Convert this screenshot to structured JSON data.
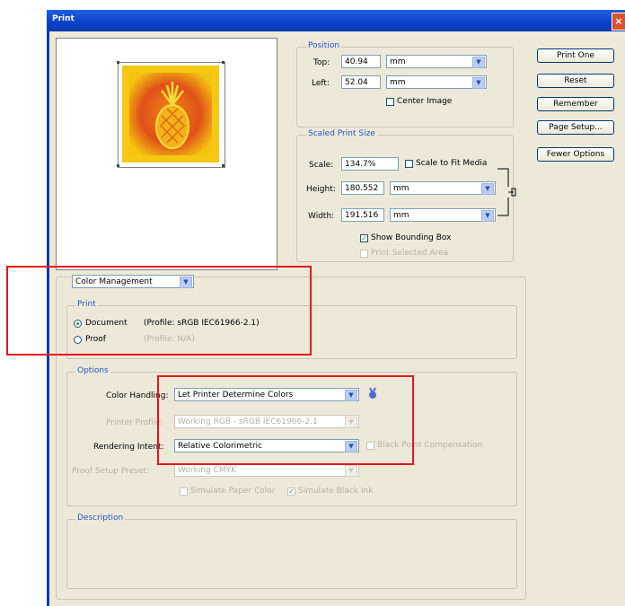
{
  "window": {
    "title": "Print",
    "close_glyph": "×"
  },
  "position": {
    "group_label": "Position",
    "top_label": "Top:",
    "top_value": "40.94",
    "top_unit": "mm",
    "left_label": "Left:",
    "left_value": "52.04",
    "left_unit": "mm",
    "center_label": "Center Image",
    "center_checked": false
  },
  "scaled": {
    "group_label": "Scaled Print Size",
    "scale_label": "Scale:",
    "scale_value": "134.7%",
    "fit_label": "Scale to Fit Media",
    "fit_checked": false,
    "height_label": "Height:",
    "height_value": "180.552",
    "height_unit": "mm",
    "width_label": "Width:",
    "width_value": "191.516",
    "width_unit": "mm",
    "bbox_label": "Show Bounding Box",
    "bbox_checked": true,
    "selected_label": "Print Selected Area"
  },
  "buttons": {
    "print_one": "Print One",
    "reset": "Reset",
    "remember": "Remember",
    "page_setup": "Page Setup...",
    "fewer": "Fewer Options"
  },
  "mode_select": "Color Management",
  "print_group": {
    "label": "Print",
    "document_label": "Document",
    "document_profile": "(Profile: sRGB IEC61966-2.1)",
    "proof_label": "Proof",
    "proof_profile": "(Profile: N/A)"
  },
  "options": {
    "label": "Options",
    "color_handling_label": "Color Handling:",
    "color_handling_value": "Let Printer Determine Colors",
    "printer_profile_label": "Printer Profile:",
    "printer_profile_value": "Working RGB - sRGB IEC61966-2.1",
    "rendering_label": "Rendering Intent:",
    "rendering_value": "Relative Colorimetric",
    "bpc_label": "Black Point Compensation",
    "proof_setup_label": "Proof Setup Preset:",
    "proof_setup_value": "Working CMYK",
    "sim_paper_label": "Simulate Paper Color",
    "sim_ink_label": "Simulate Black Ink"
  },
  "description": {
    "label": "Description"
  },
  "icons": {
    "dropdown": "chevron-down-icon",
    "info": "info-icon",
    "link": "chain-link-icon"
  },
  "colors": {
    "highlight_box": "#e8141b",
    "titlebar": "#0a3fc8",
    "group_label": "#2056c8"
  }
}
